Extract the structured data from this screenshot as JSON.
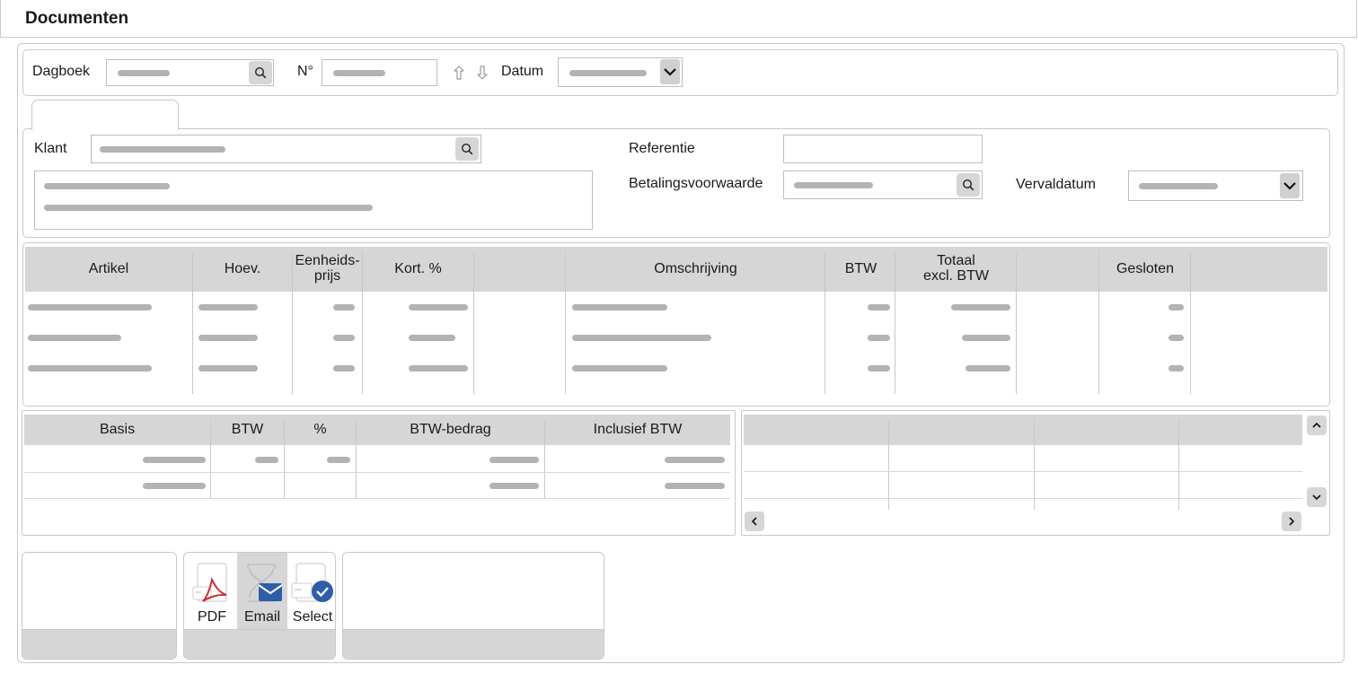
{
  "window": {
    "title": "Documenten"
  },
  "header": {
    "dagboek_label": "Dagboek",
    "nr_label": "N°",
    "datum_label": "Datum"
  },
  "customer": {
    "klant_label": "Klant",
    "referentie_label": "Referentie",
    "betalingsvoorwaarde_label": "Betalingsvoorwaarde",
    "vervaldatum_label": "Vervaldatum"
  },
  "lines_table": {
    "columns": [
      "Artikel",
      "Hoev.",
      "Eenheids-\nprijs",
      "Kort. %",
      "",
      "Omschrijving",
      "BTW",
      "Totaal\nexcl. BTW",
      "",
      "Gesloten",
      ""
    ]
  },
  "vat_table": {
    "columns": [
      "Basis",
      "BTW",
      "%",
      "BTW-bedrag",
      "Inclusief BTW"
    ]
  },
  "actions": {
    "pdf_label": "PDF",
    "email_label": "Email",
    "select_label": "Select"
  },
  "colors": {
    "accent_blue": "#2f5ea8",
    "pdf_red": "#c8333a",
    "header_gray": "#d6d6d6"
  },
  "icons": [
    "search-icon",
    "chevron-down-icon",
    "arrow-up-icon",
    "arrow-down-icon",
    "chevron-up-icon",
    "chevron-left-icon",
    "chevron-right-icon",
    "pdf-icon",
    "email-icon",
    "select-check-icon"
  ]
}
